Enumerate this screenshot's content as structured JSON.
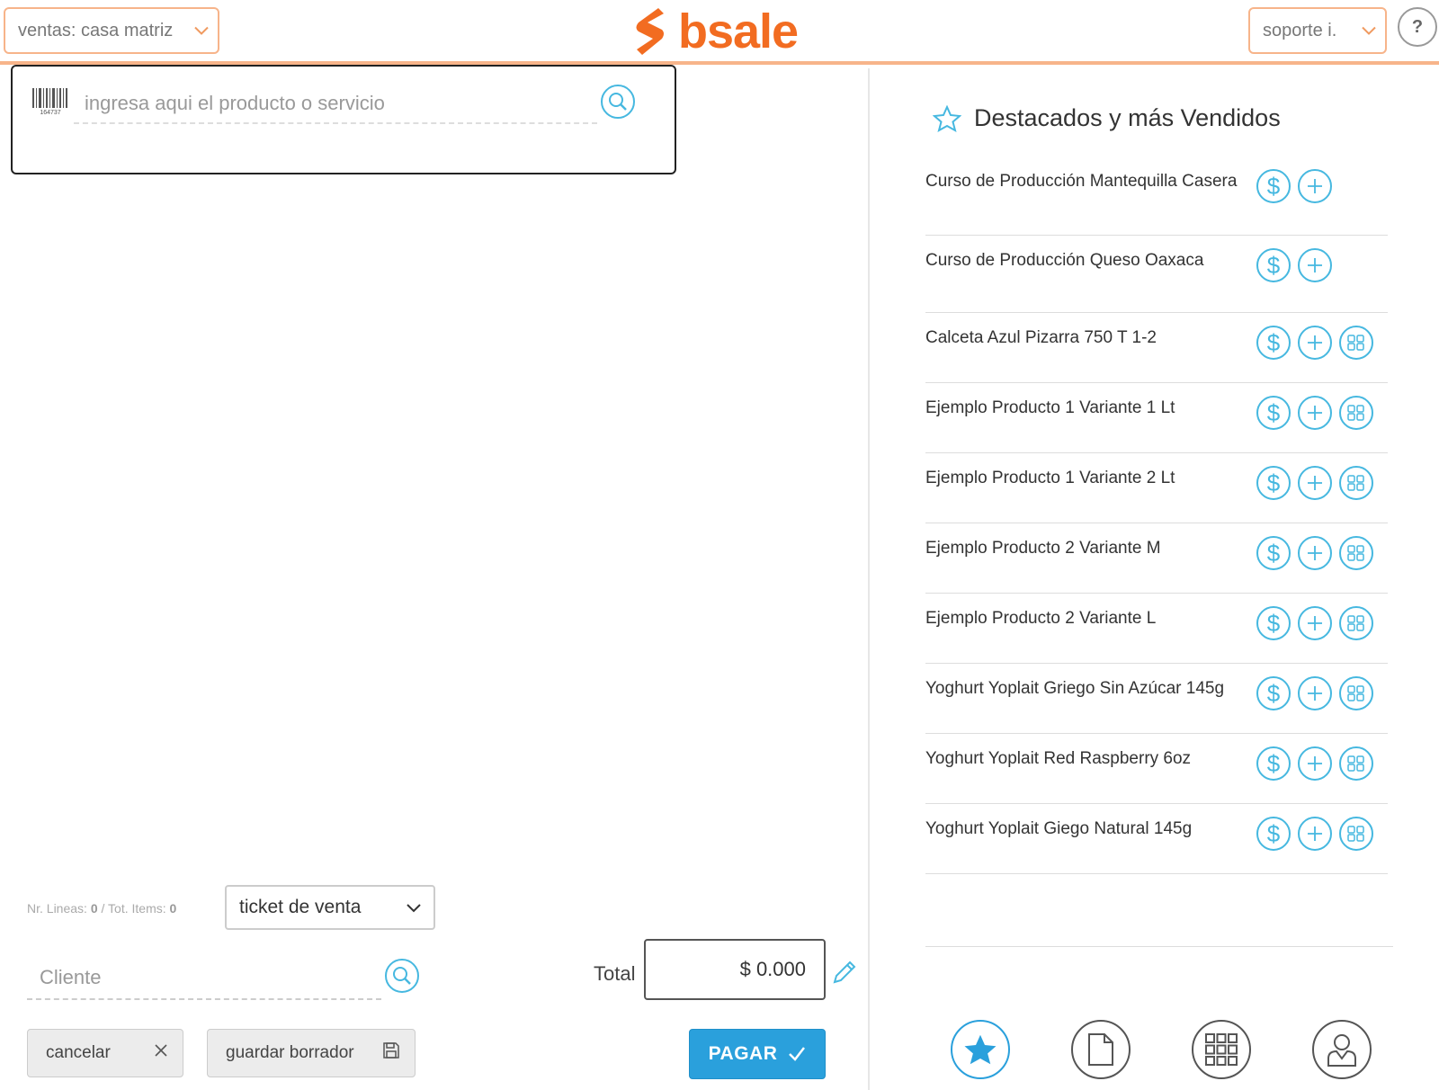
{
  "header": {
    "store_select": "ventas: casa matriz",
    "logo_text": "bsale",
    "user_select": "soporte i.",
    "help": "?"
  },
  "search": {
    "barcode_number": "164737",
    "placeholder": "ingresa aqui el producto o servicio"
  },
  "summary": {
    "lines_label": "Nr. Lineas:",
    "lines_value": "0",
    "sep": "/",
    "items_label": "Tot. Items:",
    "items_value": "0"
  },
  "document_type": "ticket de venta",
  "client": {
    "placeholder": "Cliente"
  },
  "total": {
    "label": "Total",
    "value": "$ 0.000"
  },
  "buttons": {
    "cancel": "cancelar",
    "save_draft": "guardar borrador",
    "pay": "PAGAR"
  },
  "featured": {
    "title": "Destacados y más Vendidos",
    "products": [
      {
        "name": "Curso de Producción Mantequilla Casera",
        "has_variants": false
      },
      {
        "name": "Curso de Producción Queso Oaxaca",
        "has_variants": false
      },
      {
        "name": "Calceta Azul Pizarra 750 T 1-2",
        "has_variants": true
      },
      {
        "name": "Ejemplo Producto 1 Variante 1 Lt",
        "has_variants": true
      },
      {
        "name": "Ejemplo Producto 1 Variante  2 Lt",
        "has_variants": true
      },
      {
        "name": "Ejemplo Producto 2 Variante M",
        "has_variants": true
      },
      {
        "name": "Ejemplo Producto 2 Variante L",
        "has_variants": true
      },
      {
        "name": "Yoghurt Yoplait Griego Sin Azúcar 145g",
        "has_variants": true
      },
      {
        "name": "Yoghurt Yoplait Red Raspberry 6oz",
        "has_variants": true
      },
      {
        "name": "Yoghurt Yoplait Giego Natural 145g",
        "has_variants": true
      }
    ]
  },
  "bottom_nav": [
    {
      "icon": "star-icon",
      "active": true
    },
    {
      "icon": "document-icon",
      "active": false
    },
    {
      "icon": "grid-icon",
      "active": false
    },
    {
      "icon": "user-icon",
      "active": false
    }
  ],
  "colors": {
    "brand_orange": "#f26c21",
    "accent_blue": "#46b8e0",
    "pay_blue": "#2aa0dc"
  }
}
